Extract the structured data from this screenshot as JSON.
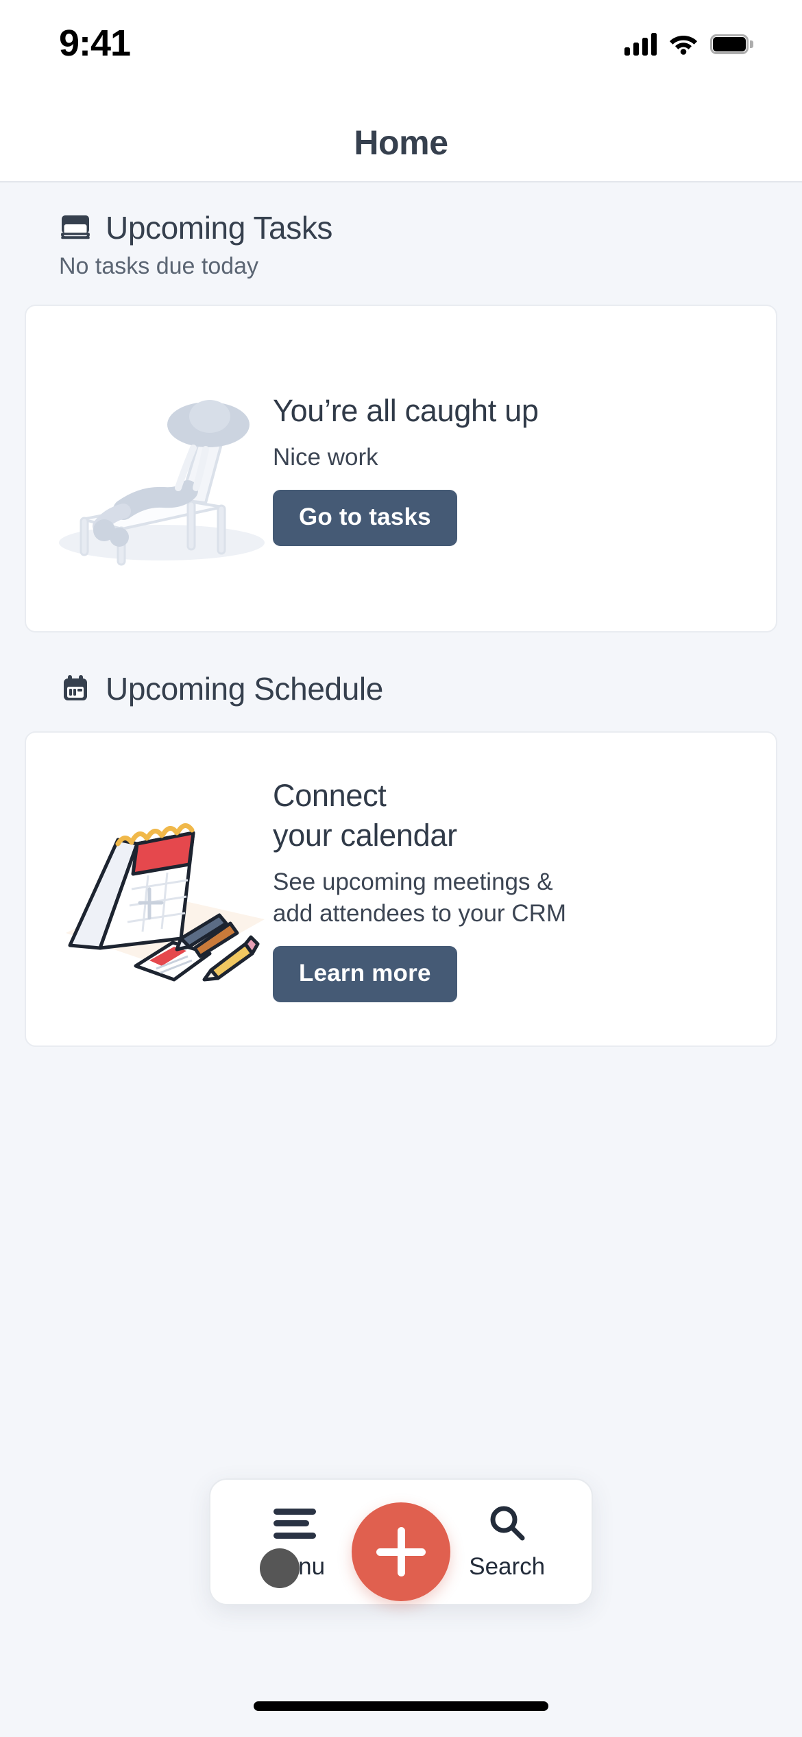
{
  "status_bar": {
    "time": "9:41",
    "cellular_icon": "signal-bars-icon",
    "wifi_icon": "wifi-icon",
    "battery_icon": "battery-full-icon"
  },
  "header": {
    "title": "Home"
  },
  "colors": {
    "page_background": "#f4f6fa",
    "card_background": "#ffffff",
    "primary_text": "#36404e",
    "secondary_text": "#5b6573",
    "button_background": "#455a75",
    "fab_background": "#e0604f",
    "badge": "#565656"
  },
  "sections": [
    {
      "id": "upcoming-tasks",
      "icon": "notebook-icon",
      "title": "Upcoming Tasks",
      "subtitle": "No tasks due today",
      "card": {
        "illustration": "person-relaxing-lounge-chair-illustration",
        "title": "You’re all caught up",
        "text": "Nice work",
        "button_label": "Go to tasks"
      }
    },
    {
      "id": "upcoming-schedule",
      "icon": "calendar-icon",
      "title": "Upcoming Schedule",
      "subtitle": "",
      "card": {
        "illustration": "desk-calendar-pens-illustration",
        "title_line1": "Connect",
        "title_line2": "your calendar",
        "text_line1": "See upcoming meetings &",
        "text_line2": "add attendees to your CRM",
        "button_label": "Learn more"
      }
    }
  ],
  "tab_bar": {
    "menu": {
      "icon": "hamburger-menu-icon",
      "label": "Menu",
      "badge": true
    },
    "create": {
      "icon": "plus-icon",
      "label": ""
    },
    "search": {
      "icon": "search-icon",
      "label": "Search"
    }
  }
}
